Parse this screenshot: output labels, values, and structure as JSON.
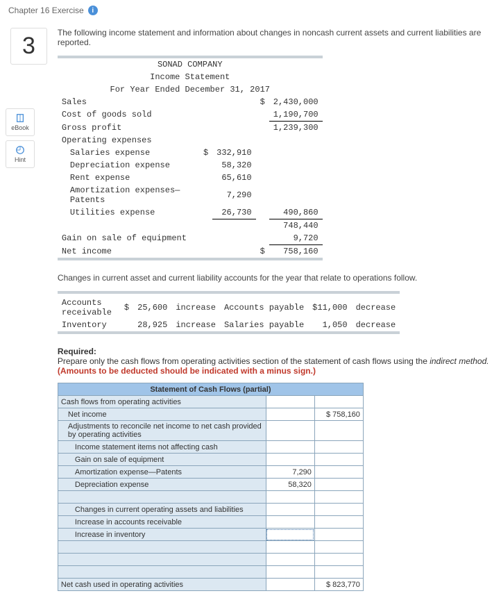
{
  "header": {
    "title": "Chapter 16 Exercise"
  },
  "question_number": "3",
  "sidebar": {
    "ebook": "eBook",
    "hint": "Hint"
  },
  "intro": "The following income statement and information about changes in noncash current assets and current liabilities are reported.",
  "inc": {
    "company": "SONAD COMPANY",
    "stmt": "Income Statement",
    "period": "For Year Ended December 31, 2017",
    "sales_lbl": "Sales",
    "sales_val": "2,430,000",
    "cogs_lbl": "Cost of goods sold",
    "cogs_val": "1,190,700",
    "gp_lbl": "Gross profit",
    "gp_val": "1,239,300",
    "opex_lbl": "Operating expenses",
    "sal_lbl": "Salaries expense",
    "sal_val": "332,910",
    "dep_lbl": "Depreciation expense",
    "dep_val": "58,320",
    "rent_lbl": "Rent expense",
    "rent_val": "65,610",
    "amort_lbl": "Amortization expenses—Patents",
    "amort_val": "7,290",
    "util_lbl": "Utilities expense",
    "util_val": "26,730",
    "opex_total": "490,860",
    "sub_val": "748,440",
    "gain_lbl": "Gain on sale of equipment",
    "gain_val": "9,720",
    "ni_lbl": "Net income",
    "ni_val": "758,160",
    "cur": "$"
  },
  "changes_intro": "Changes in current asset and current liability accounts for the year that relate to operations follow.",
  "chg": {
    "ar_lbl": "Accounts receivable",
    "ar_cur": "$",
    "ar_val": "25,600",
    "ar_dir": "increase",
    "inv_lbl": "Inventory",
    "inv_val": "28,925",
    "inv_dir": "increase",
    "ap_lbl": "Accounts payable",
    "ap_val": "$11,000",
    "ap_dir": "decrease",
    "sp_lbl": "Salaries payable",
    "sp_val": "1,050",
    "sp_dir": "decrease"
  },
  "req": {
    "head": "Required:",
    "body1": "Prepare only the cash flows from operating activities section of the statement of cash flows using the ",
    "ital": "indirect method.",
    "warn": " (Amounts to be deducted should be indicated with a minus sign.)"
  },
  "scf": {
    "title": "Statement of Cash Flows (partial)",
    "r1": "Cash flows from operating activities",
    "r2": "Net income",
    "r2v": "$  758,160",
    "r3": "Adjustments to reconcile net income to net cash provided by operating activities",
    "r4": "Income statement items not affecting cash",
    "r5": "Gain on sale of equipment",
    "r6": "Amortization expense—Patents",
    "r6v": "7,290",
    "r7": "Depreciation expense",
    "r7v": "58,320",
    "r8": "Changes in current operating assets and liabilities",
    "r9": "Increase in accounts receivable",
    "r10": "Increase in inventory",
    "rEnd": "Net cash used in operating activities",
    "rEndv": "$  823,770"
  }
}
